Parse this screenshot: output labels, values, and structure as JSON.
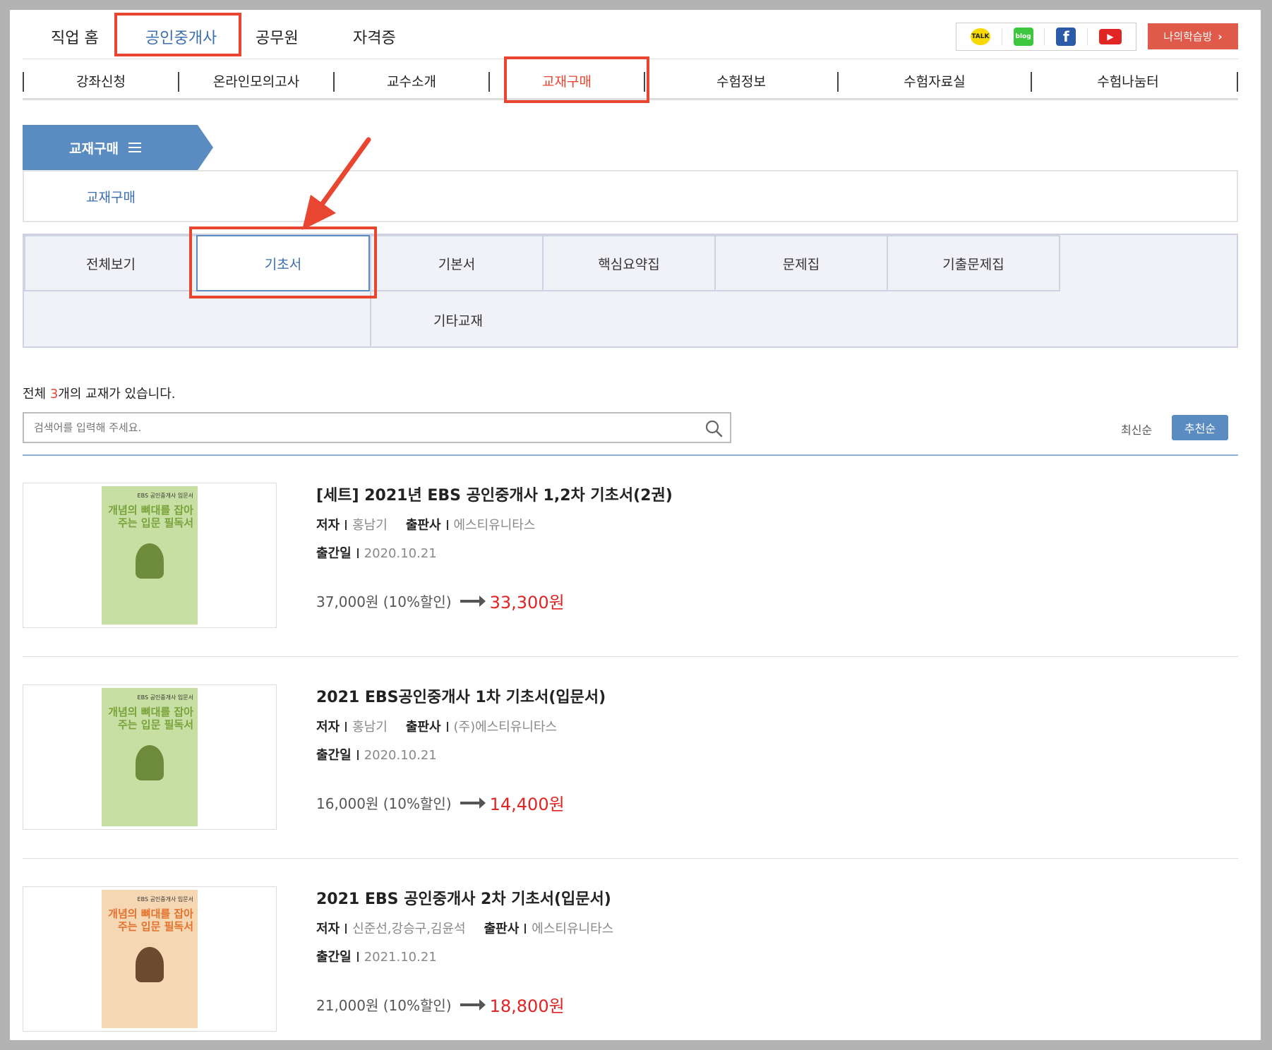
{
  "top_nav": {
    "items": [
      "직업 홈",
      "공인중개사",
      "공무원",
      "자격증"
    ],
    "active_index": 1,
    "social": [
      "TALK",
      "blog",
      "f",
      "▶"
    ],
    "my_study": "나의학습방"
  },
  "sub_nav": {
    "items": [
      "강좌신청",
      "온라인모의고사",
      "교수소개",
      "교재구매",
      "수험정보",
      "수험자료실",
      "수험나눔터"
    ],
    "active_index": 3
  },
  "category": {
    "banner": "교재구매",
    "panel_link": "교재구매"
  },
  "filters": {
    "row1": [
      "전체보기",
      "기초서",
      "기본서",
      "핵심요약집",
      "문제집",
      "기출문제집"
    ],
    "row2": [
      "기타교재"
    ],
    "active": "기초서"
  },
  "list": {
    "count_prefix": "전체 ",
    "count": "3",
    "count_suffix": "개의 교재가 있습니다.",
    "search_placeholder": "검색어를 입력해 주세요.",
    "sort_new": "최신순",
    "sort_recommend": "추천순"
  },
  "labels": {
    "author": "저자",
    "publisher": "출판사",
    "pub_date": "출간일"
  },
  "books": [
    {
      "title": "[세트] 2021년 EBS 공인중개사 1,2차 기초서(2권)",
      "author": "홍남기",
      "publisher": "에스티유니타스",
      "date": "2020.10.21",
      "price": "37,000원 (10%할인)",
      "sale": "33,300원",
      "cover_series": "EBS 공인중개사 입문서",
      "cover_title": "개념의 뼈대를 잡아주는 입문 필독서"
    },
    {
      "title": "2021 EBS공인중개사 1차 기초서(입문서)",
      "author": "홍남기",
      "publisher": "(주)에스티유니타스",
      "date": "2020.10.21",
      "price": "16,000원 (10%할인)",
      "sale": "14,400원",
      "cover_series": "EBS 공인중개사 입문서",
      "cover_title": "개념의 뼈대를 잡아주는 입문 필독서"
    },
    {
      "title": "2021 EBS 공인중개사 2차 기초서(입문서)",
      "author": "신준선,강승구,김윤석",
      "publisher": "에스티유니타스",
      "date": "2021.10.21",
      "price": "21,000원 (10%할인)",
      "sale": "18,800원",
      "cover_series": "EBS 공인중개사 입문서",
      "cover_title": "개념의 뼈대를 잡아주는 입문 필독서"
    }
  ],
  "colors": {
    "accent_blue": "#5b8cc1",
    "highlight_red": "#e84631",
    "sale_red": "#e02323"
  }
}
